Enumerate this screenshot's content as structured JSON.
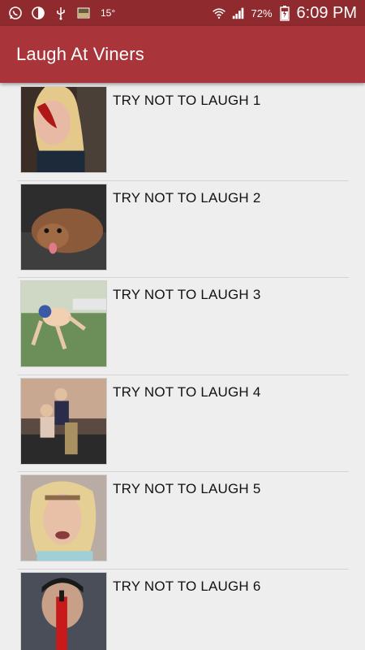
{
  "status_bar": {
    "temperature": "15°",
    "battery_percent": "72%",
    "time": "6:09 PM",
    "icons": [
      "whatsapp-icon",
      "contrast-icon",
      "usb-icon",
      "image-notification-icon",
      "wifi-icon",
      "signal-icon",
      "battery-charging-icon"
    ]
  },
  "app_bar": {
    "title": "Laugh At Viners",
    "color": "#a9343a"
  },
  "list": {
    "items": [
      {
        "title": "TRY NOT TO LAUGH 1"
      },
      {
        "title": "TRY NOT TO LAUGH 2"
      },
      {
        "title": "TRY NOT TO LAUGH 3"
      },
      {
        "title": "TRY NOT TO LAUGH 4"
      },
      {
        "title": "TRY NOT TO LAUGH 5"
      },
      {
        "title": "TRY NOT TO LAUGH 6"
      }
    ]
  }
}
